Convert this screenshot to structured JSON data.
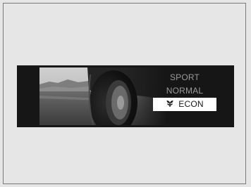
{
  "display": {
    "modes": [
      {
        "label": "SPORT",
        "selected": false
      },
      {
        "label": "NORMAL",
        "selected": false
      },
      {
        "label": "ECON",
        "selected": true,
        "icon": "econ-leaf-icon"
      }
    ],
    "colors": {
      "panel": "#161616",
      "text_inactive": "#9a9a9a",
      "highlight": "#ffffff",
      "text_active": "#161616"
    }
  }
}
